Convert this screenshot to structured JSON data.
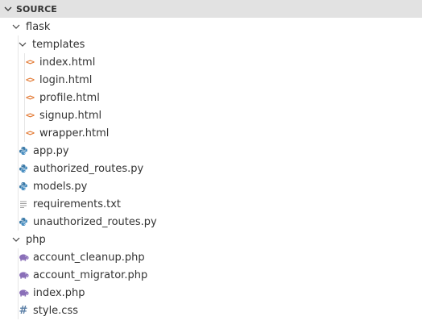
{
  "section": {
    "title": "SOURCE"
  },
  "colors": {
    "header_bg": "#e2e2e2",
    "html_icon": "#e37933",
    "python_icon": "#3b7aa8",
    "python_icon_alt": "#4a8fc2",
    "php_icon": "#8a6fb8",
    "text_icon": "#9a9a9a",
    "css_icon": "#5b7fa6"
  },
  "tree": {
    "flask": {
      "label": "flask",
      "icon": "chevron-down-icon",
      "templates": {
        "label": "templates",
        "icon": "chevron-down-icon",
        "files": [
          {
            "label": "index.html",
            "icon": "html-icon"
          },
          {
            "label": "login.html",
            "icon": "html-icon"
          },
          {
            "label": "profile.html",
            "icon": "html-icon"
          },
          {
            "label": "signup.html",
            "icon": "html-icon"
          },
          {
            "label": "wrapper.html",
            "icon": "html-icon"
          }
        ]
      },
      "files": [
        {
          "label": "app.py",
          "icon": "python-icon"
        },
        {
          "label": "authorized_routes.py",
          "icon": "python-icon"
        },
        {
          "label": "models.py",
          "icon": "python-icon"
        },
        {
          "label": "requirements.txt",
          "icon": "text-file-icon"
        },
        {
          "label": "unauthorized_routes.py",
          "icon": "python-icon"
        }
      ]
    },
    "php": {
      "label": "php",
      "icon": "chevron-down-icon",
      "files": [
        {
          "label": "account_cleanup.php",
          "icon": "php-icon"
        },
        {
          "label": "account_migrator.php",
          "icon": "php-icon"
        },
        {
          "label": "index.php",
          "icon": "php-icon"
        },
        {
          "label": "style.css",
          "icon": "css-icon"
        }
      ]
    }
  }
}
